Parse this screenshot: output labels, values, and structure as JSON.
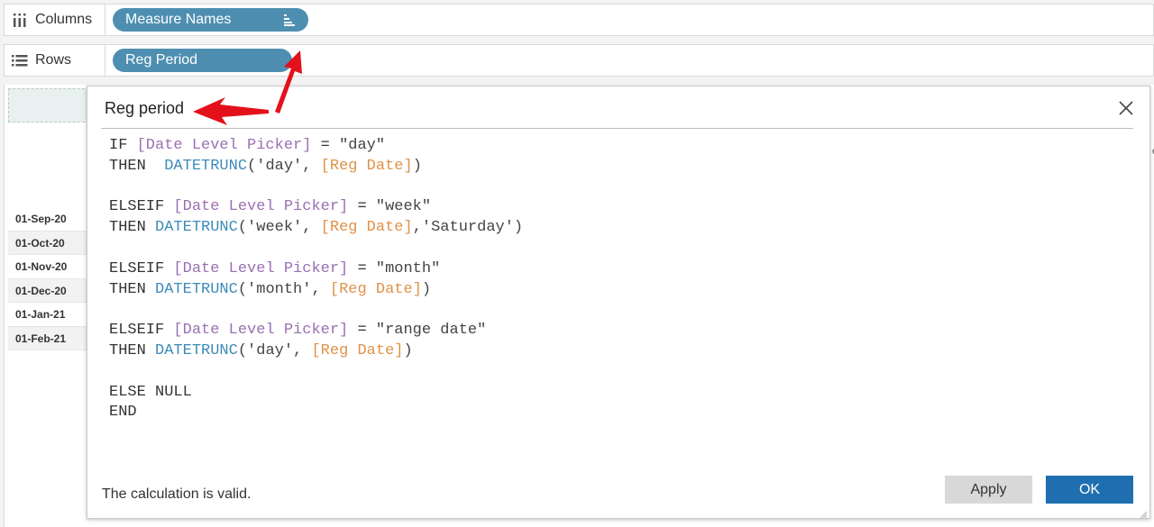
{
  "shelves": {
    "columns": {
      "label": "Columns",
      "pill": "Measure Names",
      "icon": "columns-icon"
    },
    "rows": {
      "label": "Rows",
      "pill": "Reg Period",
      "icon": "rows-icon"
    }
  },
  "row_labels": [
    "01-Sep-20",
    "01-Oct-20",
    "01-Nov-20",
    "01-Dec-20",
    "01-Jan-21",
    "01-Feb-21"
  ],
  "dialog": {
    "title": "Reg period",
    "status": "The calculation is valid.",
    "apply_label": "Apply",
    "ok_label": "OK",
    "code_lines": [
      [
        {
          "t": "IF ",
          "c": "kw"
        },
        {
          "t": "[Date Level Picker]",
          "c": "fld"
        },
        {
          "t": " = ",
          "c": "kw"
        },
        {
          "t": "\"day\"",
          "c": "str"
        }
      ],
      [
        {
          "t": "THEN  ",
          "c": "kw"
        },
        {
          "t": "DATETRUNC",
          "c": "fn"
        },
        {
          "t": "('day', ",
          "c": "str"
        },
        {
          "t": "[Reg Date]",
          "c": "dt"
        },
        {
          "t": ")",
          "c": "str"
        }
      ],
      [],
      [
        {
          "t": "ELSEIF ",
          "c": "kw"
        },
        {
          "t": "[Date Level Picker]",
          "c": "fld"
        },
        {
          "t": " = ",
          "c": "kw"
        },
        {
          "t": "\"week\"",
          "c": "str"
        }
      ],
      [
        {
          "t": "THEN ",
          "c": "kw"
        },
        {
          "t": "DATETRUNC",
          "c": "fn"
        },
        {
          "t": "('week', ",
          "c": "str"
        },
        {
          "t": "[Reg Date]",
          "c": "dt"
        },
        {
          "t": ",'Saturday')",
          "c": "str"
        }
      ],
      [],
      [
        {
          "t": "ELSEIF ",
          "c": "kw"
        },
        {
          "t": "[Date Level Picker]",
          "c": "fld"
        },
        {
          "t": " = ",
          "c": "kw"
        },
        {
          "t": "\"month\"",
          "c": "str"
        }
      ],
      [
        {
          "t": "THEN ",
          "c": "kw"
        },
        {
          "t": "DATETRUNC",
          "c": "fn"
        },
        {
          "t": "('month', ",
          "c": "str"
        },
        {
          "t": "[Reg Date]",
          "c": "dt"
        },
        {
          "t": ")",
          "c": "str"
        }
      ],
      [],
      [
        {
          "t": "ELSEIF ",
          "c": "kw"
        },
        {
          "t": "[Date Level Picker]",
          "c": "fld"
        },
        {
          "t": " = ",
          "c": "kw"
        },
        {
          "t": "\"range date\"",
          "c": "str"
        }
      ],
      [
        {
          "t": "THEN ",
          "c": "kw"
        },
        {
          "t": "DATETRUNC",
          "c": "fn"
        },
        {
          "t": "('day', ",
          "c": "str"
        },
        {
          "t": "[Reg Date]",
          "c": "dt"
        },
        {
          "t": ")",
          "c": "str"
        }
      ],
      [],
      [
        {
          "t": "ELSE NULL",
          "c": "kw"
        }
      ],
      [
        {
          "t": "END",
          "c": "kw"
        }
      ]
    ]
  },
  "colors": {
    "pill": "#4e8fb1",
    "ok_button": "#1f6fb0",
    "field": "#9b6fb3",
    "function": "#3d8bb8",
    "date_field": "#e0924a",
    "annotation_arrow": "#e3111b"
  }
}
